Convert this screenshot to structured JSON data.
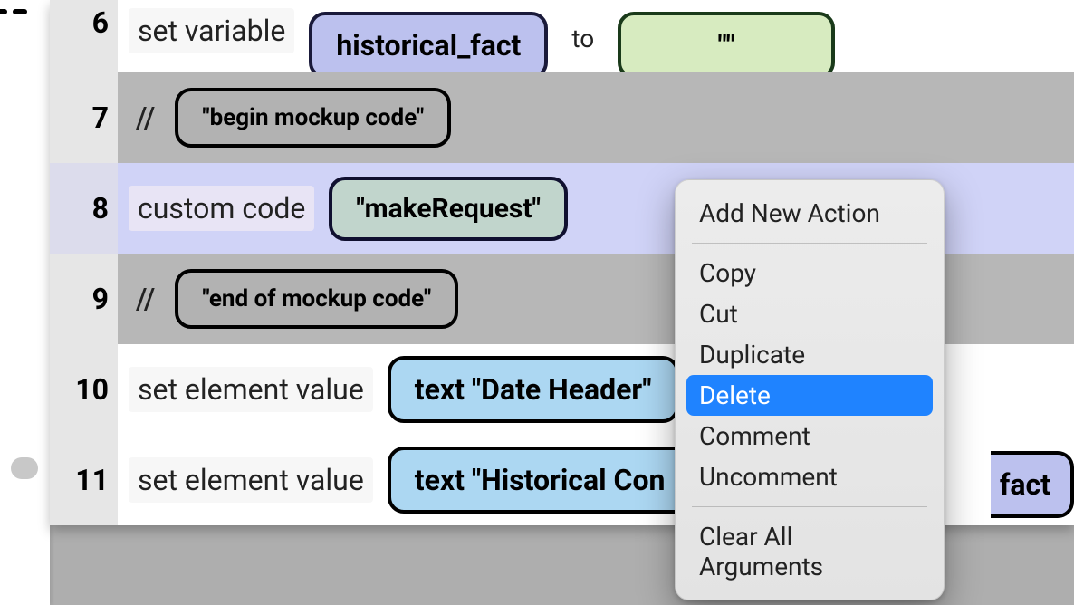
{
  "rows": {
    "r6": {
      "num": "6",
      "action": "set variable",
      "var_name": "historical_fact",
      "to": "to",
      "value": "\"\""
    },
    "r7": {
      "num": "7",
      "slash": "//",
      "comment": "\"begin  mockup code\""
    },
    "r8": {
      "num": "8",
      "action": "custom code",
      "value": "\"makeRequest\""
    },
    "r9": {
      "num": "9",
      "slash": "//",
      "comment": "\"end of mockup code\""
    },
    "r10": {
      "num": "10",
      "action": "set element value",
      "target": "text \"Date Header\""
    },
    "r11": {
      "num": "11",
      "action": "set element value",
      "target": "text \"Historical Con",
      "trailing": "fact"
    }
  },
  "menu": {
    "add": "Add New Action",
    "copy": "Copy",
    "cut": "Cut",
    "duplicate": "Duplicate",
    "delete": "Delete",
    "comment": "Comment",
    "uncomment": "Uncomment",
    "clear": "Clear All Arguments"
  }
}
